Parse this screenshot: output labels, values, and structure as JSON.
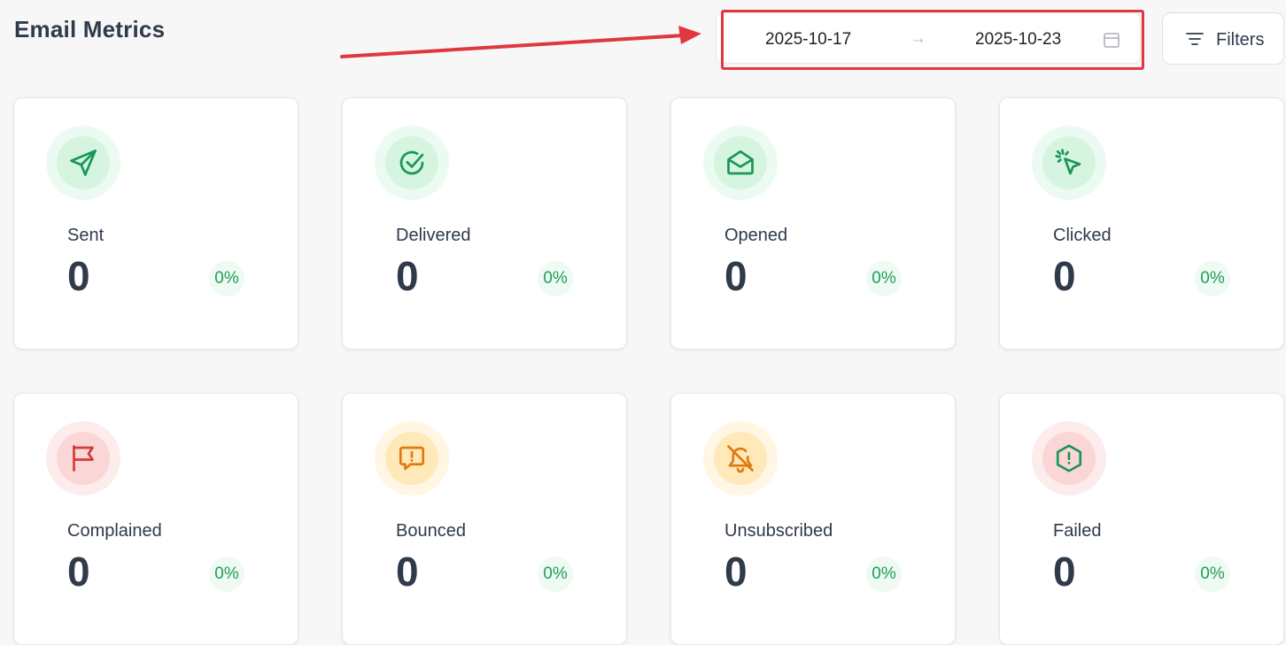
{
  "header": {
    "title": "Email Metrics",
    "date_range": {
      "start": "2025-10-17",
      "separator": "→",
      "end": "2025-10-23",
      "calendar_icon": "calendar-icon"
    },
    "filters_label": "Filters",
    "filters_icon": "filter-lines-icon"
  },
  "annotation": {
    "arrow_color": "#e0383e",
    "highlight_color": "#e0383e"
  },
  "colors": {
    "green": "#1a9656",
    "red": "#d63a3a",
    "orange": "#e07a0f",
    "text": "#2f3a4a"
  },
  "metrics": [
    {
      "label": "Sent",
      "value": "0",
      "percent": "0%",
      "icon": "send-icon",
      "tone": "green"
    },
    {
      "label": "Delivered",
      "value": "0",
      "percent": "0%",
      "icon": "check-circle-icon",
      "tone": "green"
    },
    {
      "label": "Opened",
      "value": "0",
      "percent": "0%",
      "icon": "mail-open-icon",
      "tone": "green"
    },
    {
      "label": "Clicked",
      "value": "0",
      "percent": "0%",
      "icon": "click-pointer-icon",
      "tone": "green"
    },
    {
      "label": "Complained",
      "value": "0",
      "percent": "0%",
      "icon": "flag-icon",
      "tone": "red"
    },
    {
      "label": "Bounced",
      "value": "0",
      "percent": "0%",
      "icon": "message-alert-icon",
      "tone": "orange"
    },
    {
      "label": "Unsubscribed",
      "value": "0",
      "percent": "0%",
      "icon": "bell-off-icon",
      "tone": "orange"
    },
    {
      "label": "Failed",
      "value": "0",
      "percent": "0%",
      "icon": "alert-hexagon-icon",
      "tone": "red"
    }
  ]
}
